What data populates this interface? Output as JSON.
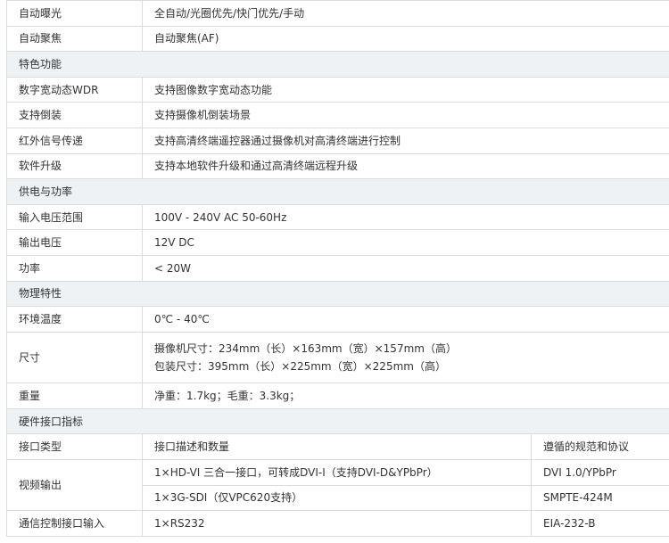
{
  "rows1": [
    {
      "label": "自动曝光",
      "value": "全自动/光圈优先/快门优先/手动"
    },
    {
      "label": "自动聚焦",
      "value": "自动聚焦(AF)"
    }
  ],
  "section_features": "特色功能",
  "features": [
    {
      "label": "数字宽动态WDR",
      "value": "支持图像数字宽动态功能"
    },
    {
      "label": "支持倒装",
      "value": "支持摄像机倒装场景"
    },
    {
      "label": "红外信号传递",
      "value": "支持高清终端遥控器通过摄像机对高清终端进行控制"
    },
    {
      "label": "软件升级",
      "value": "支持本地软件升级和通过高清终端远程升级"
    }
  ],
  "section_power": "供电与功率",
  "power": [
    {
      "label": "输入电压范围",
      "value": "100V - 240V AC 50-60Hz"
    },
    {
      "label": "输出电压",
      "value": "12V DC"
    },
    {
      "label": "功率",
      "value": "< 20W"
    }
  ],
  "section_physical": "物理特性",
  "physical": {
    "temp_label": "环境温度",
    "temp_value": "0℃ - 40℃",
    "size_label": "尺寸",
    "size_line1": "摄像机尺寸：234mm（长）×163mm（宽）×157mm（高）",
    "size_line2": "包装尺寸：395mm（长）×225mm（宽）×225mm（高）",
    "weight_label": "重量",
    "weight_value": "净重：1.7kg；毛重：3.3kg；"
  },
  "section_hardware": "硬件接口指标",
  "hardware": {
    "header": {
      "type": "接口类型",
      "desc": "接口描述和数量",
      "spec": "遵循的规范和协议"
    },
    "video_label": "视频输出",
    "video_rows": [
      {
        "desc": "1×HD-VI 三合一接口，可转成DVI-I（支持DVI-D&YPbPr）",
        "spec": "DVI 1.0/YPbPr"
      },
      {
        "desc": "1×3G-SDI（仅VPC620支持）",
        "spec": "SMPTE-424M"
      }
    ],
    "comm_label": "通信控制接口输入",
    "comm_desc": "1×RS232",
    "comm_spec": "EIA-232-B"
  }
}
